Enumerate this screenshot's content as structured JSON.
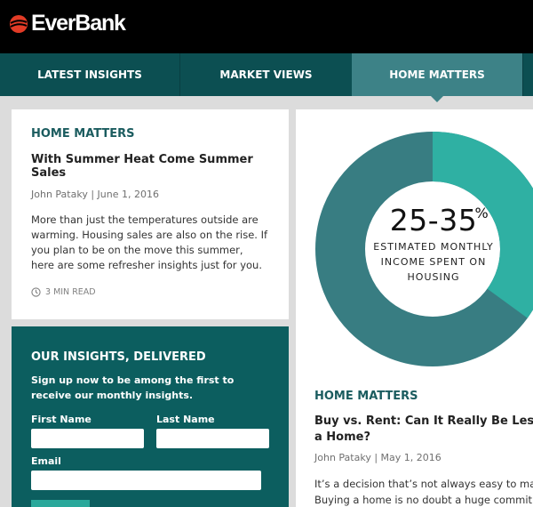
{
  "brand": {
    "name": "EverBank",
    "mark_color": "#e23b26"
  },
  "nav": {
    "items": [
      {
        "label": "LATEST INSIGHTS"
      },
      {
        "label": "MARKET VIEWS"
      },
      {
        "label": "HOME MATTERS",
        "active": true
      }
    ]
  },
  "article_left": {
    "category": "HOME MATTERS",
    "headline": "With Summer Heat Come Summer Sales",
    "byline": "John Pataky | June 1, 2016",
    "excerpt": "More than just the temperatures outside are warming. Housing sales are also on the rise. If you plan to be on the move this summer, here are some refresher insights just for you.",
    "read_time": "3 MIN READ"
  },
  "signup": {
    "title": "OUR INSIGHTS, DELIVERED",
    "description": "Sign up now to be among the first to receive our monthly insights.",
    "first_name_label": "First Name",
    "last_name_label": "Last Name",
    "email_label": "Email"
  },
  "infographic": {
    "value": "25-35",
    "unit": "%",
    "caption": "ESTIMATED MONTHLY INCOME SPENT ON HOUSING",
    "highlight_fraction": 0.35,
    "colors": {
      "main": "#387d82",
      "highlight": "#2fb0a3"
    }
  },
  "article_right": {
    "category": "HOME MATTERS",
    "headline": "Buy vs. Rent: Can It Really Be Less Expensive to Own a Home?",
    "byline": "John Pataky | May 1, 2016",
    "excerpt": "It’s a decision that’s not always easy to make. Buying a home is no doubt a huge commitment."
  }
}
